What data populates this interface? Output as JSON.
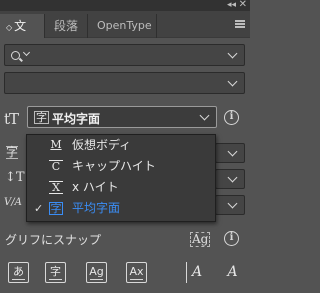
{
  "window": {
    "collapse_glyph": "◂◂",
    "close_glyph": "✕"
  },
  "tabs": [
    {
      "label": "文字",
      "active": true,
      "dropdown_glyph": "◇"
    },
    {
      "label": "段落"
    },
    {
      "label": "OpenType"
    }
  ],
  "font_family": {
    "value": ""
  },
  "font_style": {
    "value": ""
  },
  "font_size_icon": "tT",
  "alignment_select": {
    "value": "平均字面",
    "icon_glyph": "字"
  },
  "alignment_menu": [
    {
      "label": "仮想ボディ",
      "icon_glyph": "M",
      "selected": false
    },
    {
      "label": "キャップハイト",
      "icon_glyph": "C",
      "selected": false
    },
    {
      "label": "x ハイト",
      "icon_glyph": "X",
      "selected": false
    },
    {
      "label": "平均字面",
      "icon_glyph": "字",
      "selected": true,
      "check": "✓"
    }
  ],
  "side_icons": {
    "leading": "字",
    "tracking": "↕T",
    "kerning": "V/A"
  },
  "snap": {
    "label": "グリフにスナップ",
    "glyph_icon": "Ag"
  },
  "bottom_buttons": [
    {
      "glyph": "あ"
    },
    {
      "glyph": "字"
    },
    {
      "glyph": "Ag"
    },
    {
      "glyph": "Ax"
    },
    {
      "glyph": "A"
    },
    {
      "glyph": "A"
    }
  ],
  "info_glyph": "i",
  "colors": {
    "accent": "#3a8df5",
    "panel": "#535353",
    "field": "#454545"
  }
}
